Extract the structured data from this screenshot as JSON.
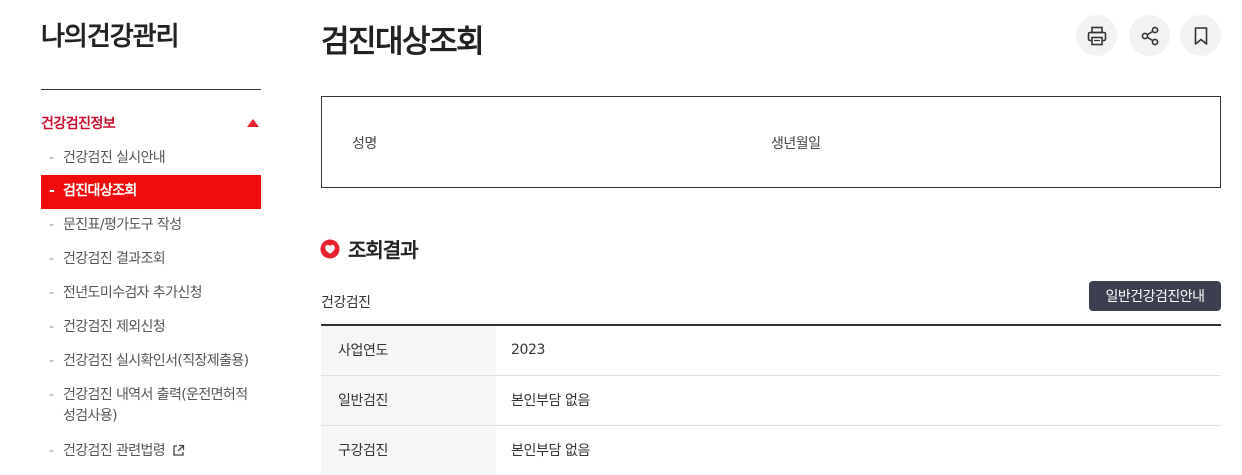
{
  "sidebar": {
    "title": "나의건강관리",
    "section_label": "건강검진정보",
    "items": [
      {
        "dash": "-",
        "label": "건강검진 실시안내"
      },
      {
        "dash": "-",
        "label": "검진대상조회"
      },
      {
        "dash": "-",
        "label": "문진표/평가도구 작성"
      },
      {
        "dash": "-",
        "label": "건강검진 결과조회"
      },
      {
        "dash": "-",
        "label": "전년도미수검자 추가신청"
      },
      {
        "dash": "-",
        "label": "건강검진 제외신청"
      },
      {
        "dash": "-",
        "label": "건강검진 실시확인서(직장제출용)"
      },
      {
        "dash": "-",
        "label": "건강검진 내역서 출력(운전면허적성검사용)"
      },
      {
        "dash": "-",
        "label": "건강검진 관련법령"
      }
    ],
    "active_index": 1
  },
  "header": {
    "title": "검진대상조회",
    "icons": [
      "printer-icon",
      "share-icon",
      "bookmark-icon"
    ]
  },
  "info": {
    "name_label": "성명",
    "birth_label": "생년월일"
  },
  "result": {
    "title": "조회결과",
    "section_title": "건강검진",
    "guide_button": "일반건강검진안내",
    "rows": [
      {
        "label": "사업연도",
        "value": "2023"
      },
      {
        "label": "일반검진",
        "value": "본인부담 없음"
      },
      {
        "label": "구강검진",
        "value": "본인부담 없음"
      }
    ]
  },
  "colors": {
    "accent_red": "#ee0c0c",
    "section_red": "#c8102e",
    "dark_button": "#3b3f4f"
  }
}
